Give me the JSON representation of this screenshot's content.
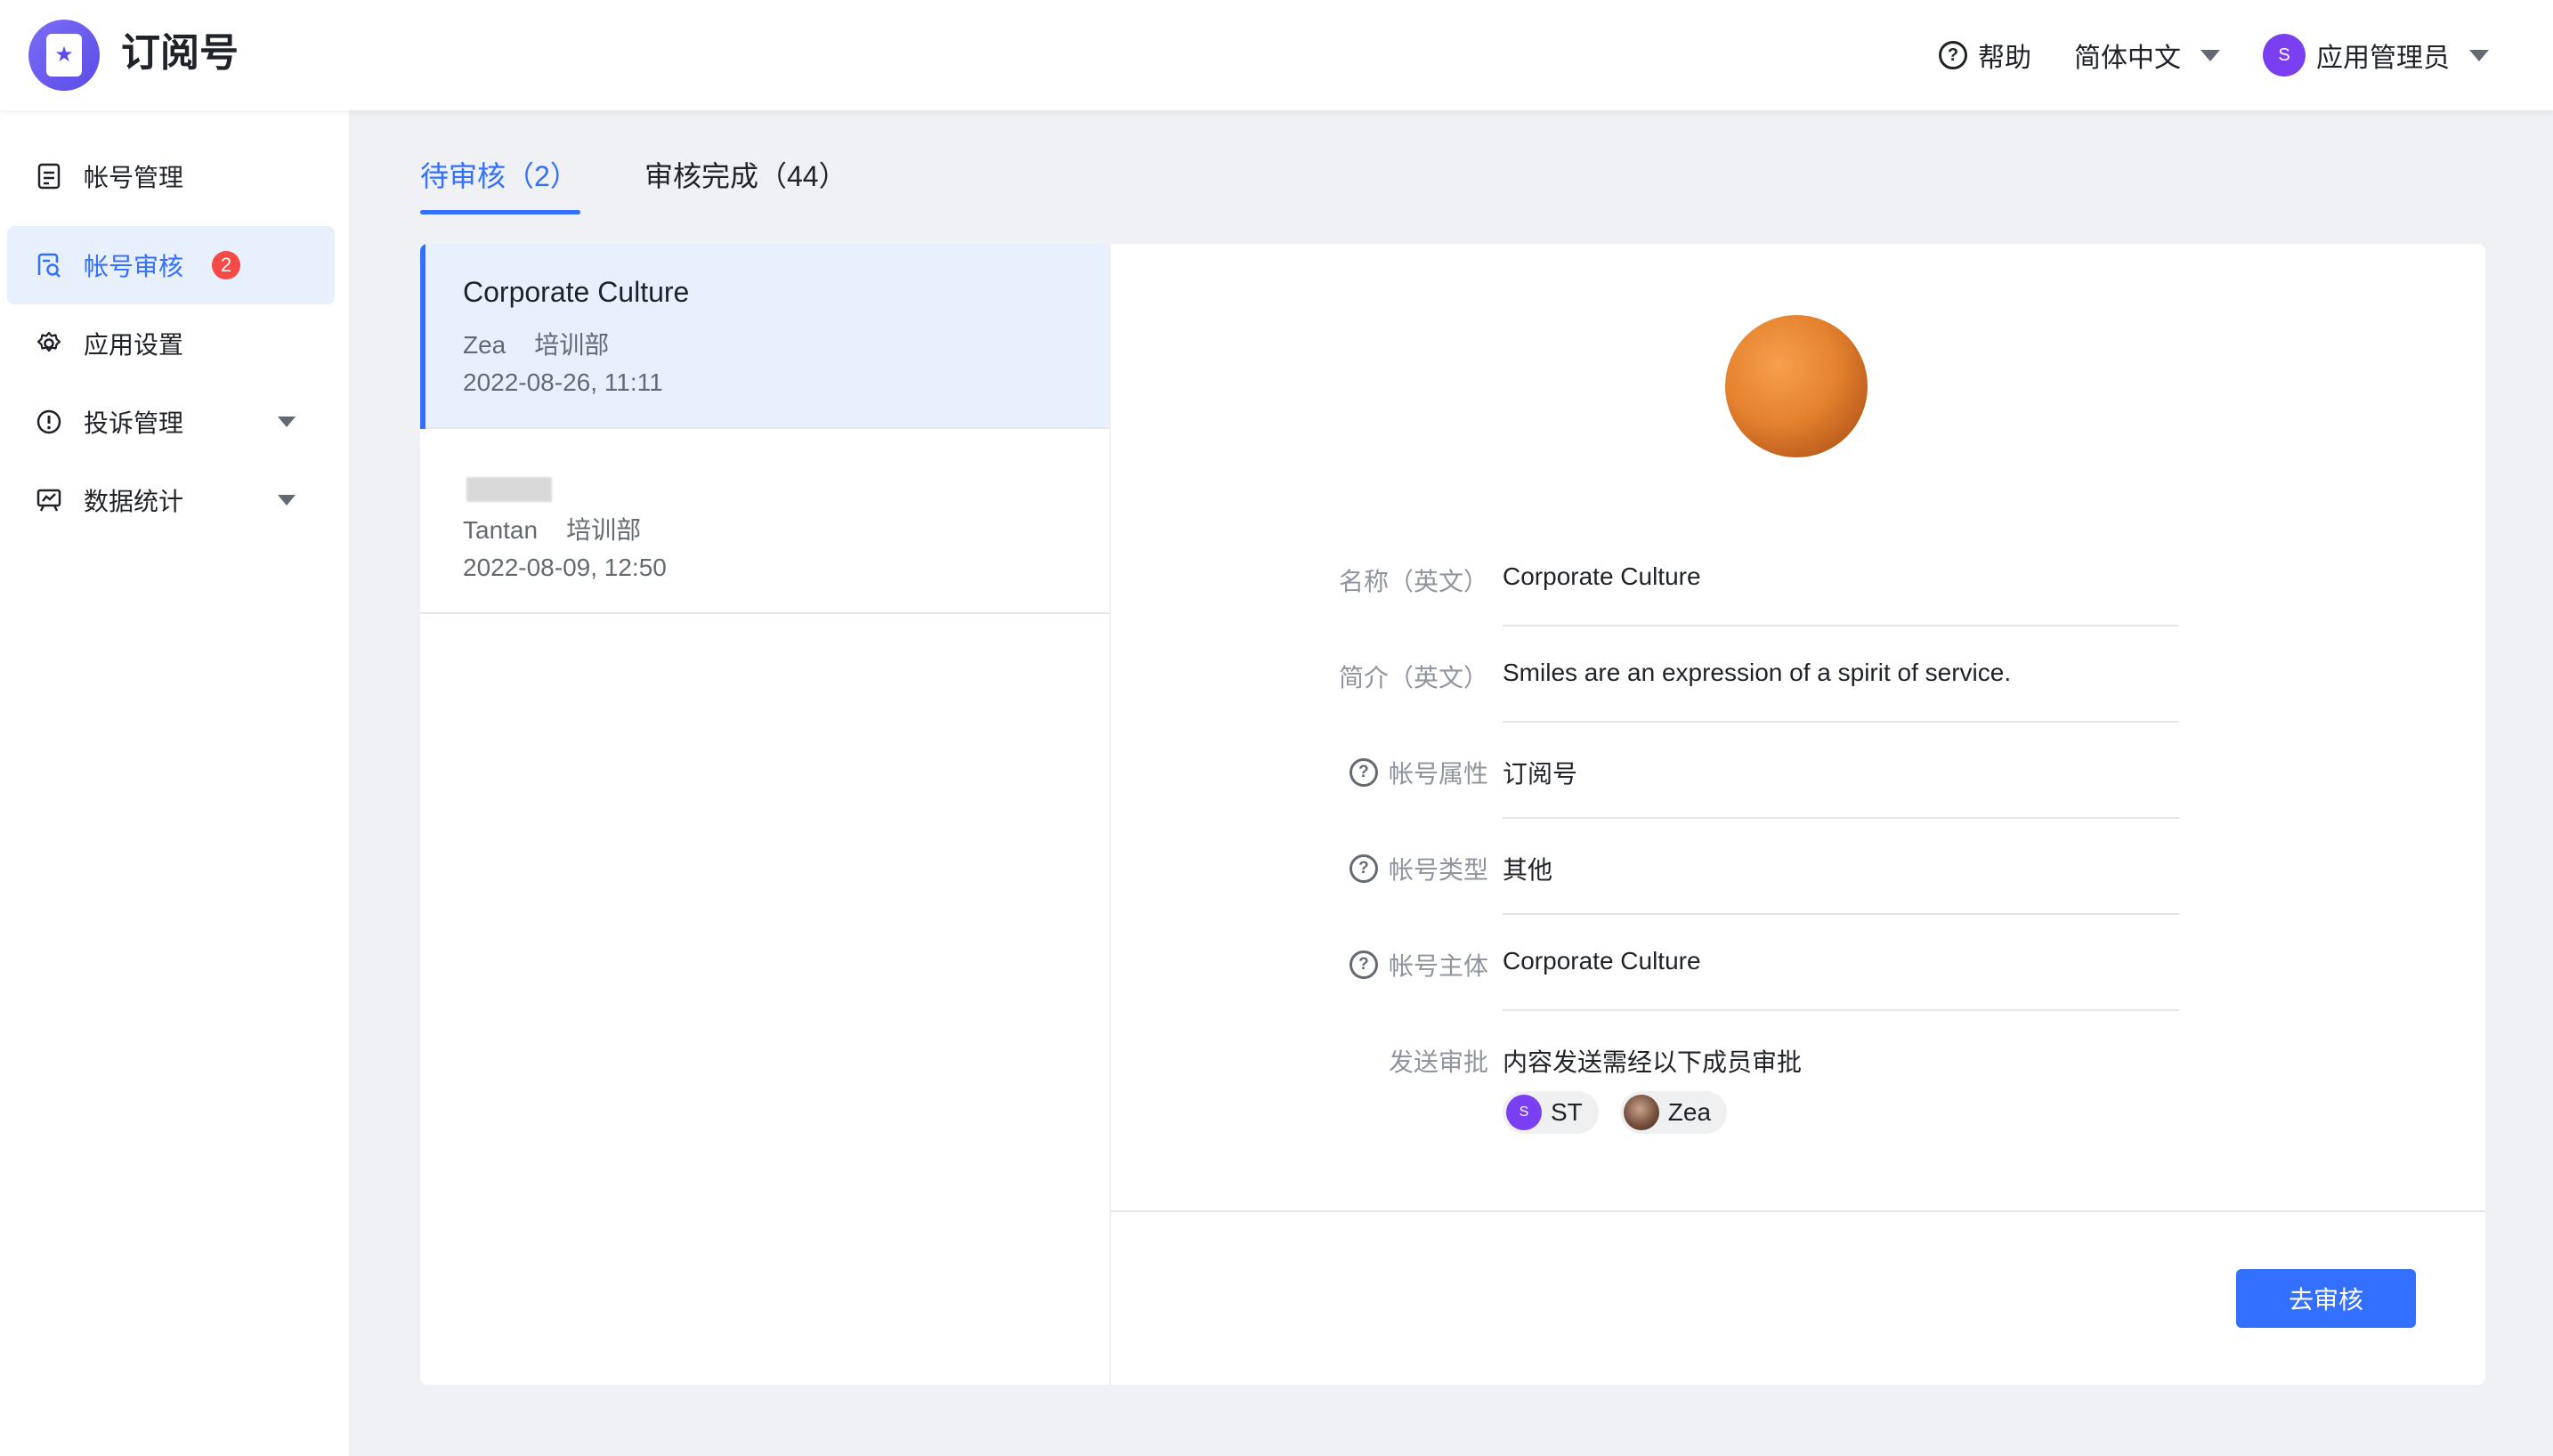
{
  "header": {
    "app_title": "订阅号",
    "help_label": "帮助",
    "language_label": "简体中文",
    "user_avatar_initial": "S",
    "user_name": "应用管理员",
    "logo_icon": "star-document-icon"
  },
  "sidebar": {
    "items": [
      {
        "label": "帐号管理",
        "icon": "document-icon"
      },
      {
        "label": "帐号审核",
        "icon": "review-search-icon",
        "badge": "2",
        "active": true
      },
      {
        "label": "应用设置",
        "icon": "gear-icon"
      },
      {
        "label": "投诉管理",
        "icon": "alert-circle-icon",
        "expandable": true
      },
      {
        "label": "数据统计",
        "icon": "chart-board-icon",
        "expandable": true
      }
    ]
  },
  "tabs": [
    {
      "label": "待审核（2）",
      "active": true
    },
    {
      "label": "审核完成（44）",
      "active": false
    }
  ],
  "list": {
    "items": [
      {
        "title": "Corporate Culture",
        "author": "Zea",
        "department": "培训部",
        "date": "2022-08-26, 11:11",
        "selected": true
      },
      {
        "title": "",
        "author": "Tantan",
        "department": "培训部",
        "date": "2022-08-09, 12:50",
        "selected": false
      }
    ]
  },
  "detail": {
    "fields": [
      {
        "label": "名称（英文）",
        "value": "Corporate Culture",
        "has_help": false
      },
      {
        "label": "简介（英文）",
        "value": "Smiles are an expression of a spirit of service.",
        "has_help": false
      },
      {
        "label": "帐号属性",
        "value": "订阅号",
        "has_help": true
      },
      {
        "label": "帐号类型",
        "value": "其他",
        "has_help": true
      },
      {
        "label": "帐号主体",
        "value": "Corporate Culture",
        "has_help": true
      },
      {
        "label": "发送审批",
        "value": "内容发送需经以下成员审批",
        "has_help": false
      }
    ],
    "approvers": [
      {
        "name": "ST",
        "avatar_initial": "S"
      },
      {
        "name": "Zea",
        "avatar_initial": ""
      }
    ],
    "review_button_label": "去审核"
  },
  "colors": {
    "accent": "#3370ff",
    "badge": "#f54a45",
    "selected_bg": "#e8effd",
    "user_avatar": "#7b3ff2"
  }
}
